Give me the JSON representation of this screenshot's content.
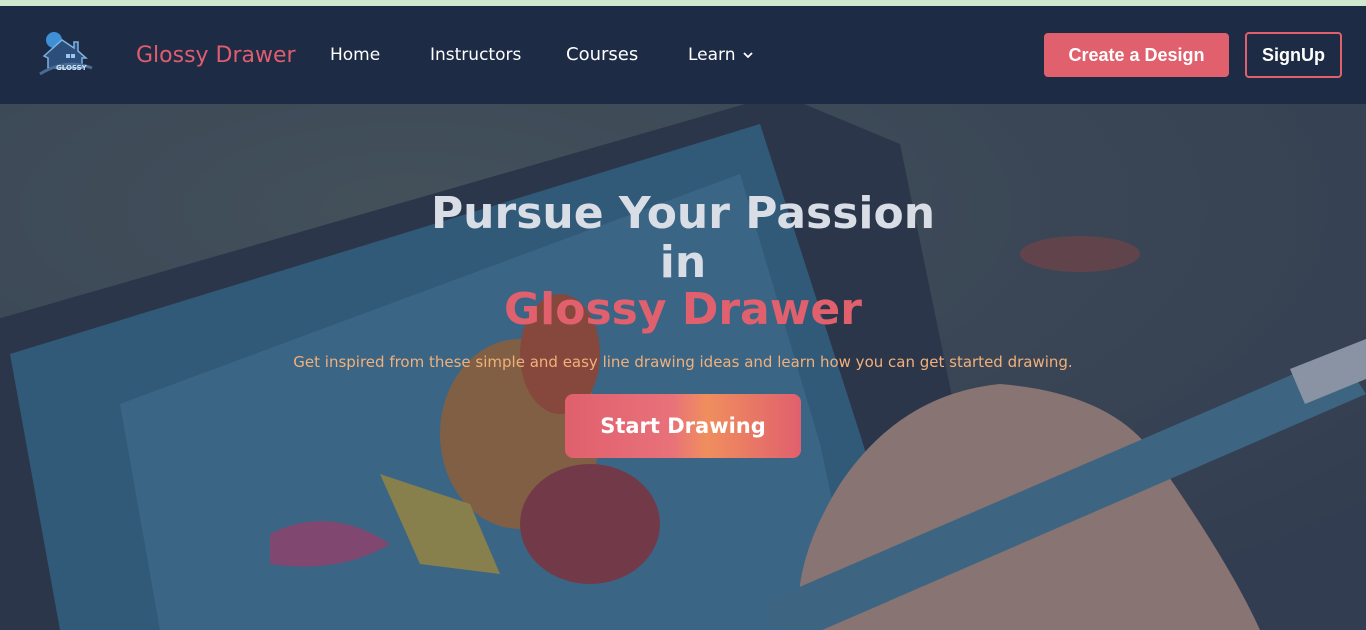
{
  "nav": {
    "brand": "Glossy Drawer",
    "logo_text": "GLOSSY",
    "links": [
      {
        "label": "Home"
      },
      {
        "label": "Instructors"
      },
      {
        "label": "Courses"
      },
      {
        "label": "Learn",
        "icon": "chevron-down-icon"
      }
    ],
    "create_label": "Create a Design",
    "signup_label": "SignUp"
  },
  "hero": {
    "line1": "Pursue Your Passion",
    "line2": "in",
    "line3": "Glossy Drawer",
    "subtext": "Get inspired from these simple and easy line drawing ideas and learn how you can get started drawing.",
    "cta_label": "Start Drawing"
  },
  "colors": {
    "nav_bg": "#1d2b45",
    "accent": "#e0606d",
    "subtext": "#f2b07a",
    "top_strip": "#cfe8cf"
  }
}
